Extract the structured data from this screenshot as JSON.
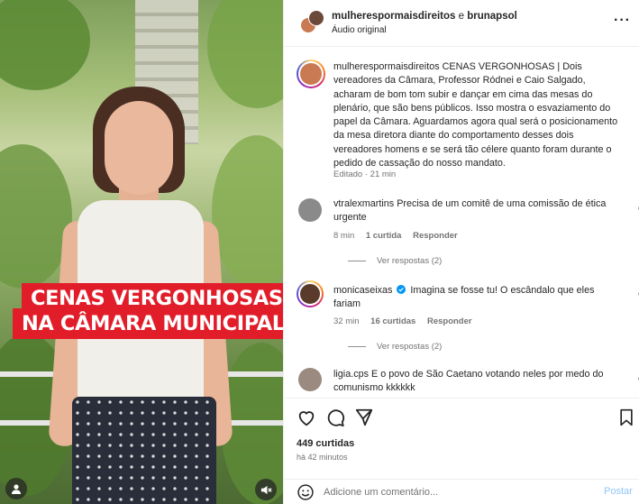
{
  "video": {
    "banner_line1": "CENAS VERGONHOSAS",
    "banner_line2": "NA CÂMARA MUNICIPAL!",
    "banner_color": "#e21d2a",
    "user_icon": "user-icon",
    "mute_icon": "speaker-muted-icon"
  },
  "header": {
    "account1": "mulherespormaisdireitos",
    "conj": "e",
    "account2": "brunapsol",
    "audio": "Áudio original",
    "more_icon": "more-horizontal-icon"
  },
  "caption": {
    "username": "mulherespormaisdireitos",
    "text": "CENAS VERGONHOSAS | Dois vereadores da Câmara, Professor Ródnei e Caio Salgado, acharam de bom tom subir e dançar em cima das mesas do plenário, que são bens públicos. Isso mostra o esvaziamento do papel da Câmara. Aguardamos agora qual será o posicionamento da mesa diretora diante do comportamento desses dois vereadores homens e se será tão célere quanto foram durante o pedido de cassação do nosso mandato.",
    "meta": "Editado · 21 min"
  },
  "comments": [
    {
      "username": "vtralexmartins",
      "text": "Precisa de um comitê de uma comissão de ética urgente",
      "time": "8 min",
      "likes": "1 curtida",
      "reply": "Responder",
      "replies": "Ver respostas (2)",
      "verified": false
    },
    {
      "username": "monicaseixas",
      "text": "Imagina se fosse tu! O escândalo que eles fariam",
      "time": "32 min",
      "likes": "16 curtidas",
      "reply": "Responder",
      "replies": "Ver respostas (2)",
      "verified": true
    },
    {
      "username": "ligia.cps",
      "text": "E o povo de São Caetano votando neles por medo do comunismo kkkkkk",
      "verified": false
    }
  ],
  "actions": {
    "like_icon": "heart-icon",
    "comment_icon": "comment-icon",
    "share_icon": "send-icon",
    "save_icon": "bookmark-icon",
    "likes": "449 curtidas",
    "time": "há 42 minutos"
  },
  "composer": {
    "emoji_icon": "emoji-icon",
    "placeholder": "Adicione um comentário...",
    "value": "",
    "post": "Postar",
    "post_color": "#8fc6f5"
  }
}
